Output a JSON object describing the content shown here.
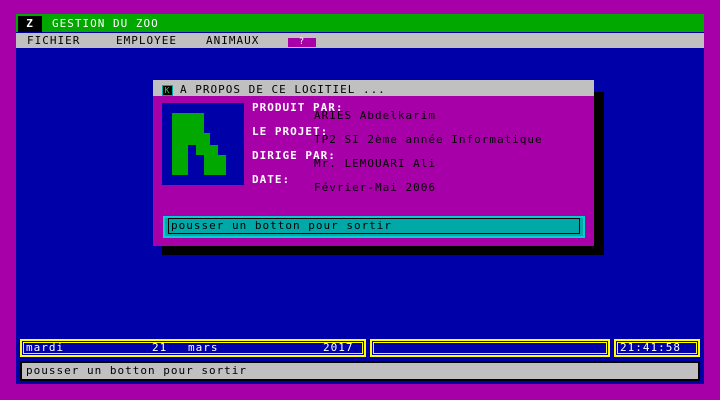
{
  "app": {
    "icon_letter": "Z",
    "title": "GESTION DU ZOO"
  },
  "menu": {
    "items": [
      {
        "label": "FICHIER"
      },
      {
        "label": "EMPLOYEE"
      },
      {
        "label": "ANIMAUX"
      }
    ],
    "help_label": "?"
  },
  "dialog": {
    "icon_letter": "K",
    "title": "A PROPOS DE CE LOGITIEL ...",
    "fields": {
      "produit_label": "PRODUIT PAR:",
      "produit_value": "ARIES Abdelkarim",
      "projet_label": "LE PROJET:",
      "projet_value": "TP2 SI 2ème année Informatique",
      "dirige_label": "DIRIGE PAR:",
      "dirige_value": "Mr. LEMOUARI Ali",
      "date_label": "DATE:",
      "date_value": "Février-Mai 2006"
    },
    "exit_prompt": "pousser un botton pour sortir"
  },
  "status": {
    "day": "mardi",
    "date_num": "21",
    "month": "mars",
    "year": "2017",
    "time": "21:41:58"
  },
  "bottom_message": "pousser un botton pour sortir",
  "colors": {
    "background": "#a800a8",
    "screen": "#0000a8",
    "titlebar": "#00a800",
    "menubar": "#c0c0c0",
    "dialog": "#a800a8",
    "exit_field": "#00a8a8",
    "status_border": "#ffff00"
  }
}
